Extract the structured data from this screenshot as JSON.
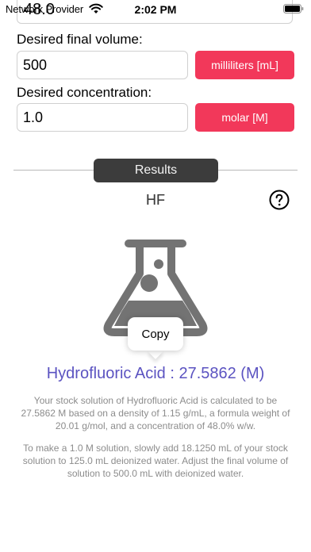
{
  "status_bar": {
    "carrier": "Network Provider",
    "time": "2:02 PM",
    "wifi_icon": "wifi-icon",
    "battery_icon": "battery-icon"
  },
  "form": {
    "top_field_value": "48.0",
    "volume_label": "Desired final volume:",
    "volume_value": "500",
    "volume_unit": "milliliters [mL]",
    "concentration_label": "Desired concentration:",
    "concentration_value": "1.0",
    "concentration_unit": "molar [M]"
  },
  "results": {
    "header": "Results",
    "formula": "HF",
    "help_icon": "question-circle-icon",
    "flask_icon": "flask-icon",
    "copy_label": "Copy",
    "title": "Hydrofluoric Acid : 27.5862 (M)",
    "paragraph_1": "Your stock solution of Hydrofluoric Acid is calculated to be 27.5862 M based on a density of 1.15 g/mL, a formula weight of 20.01 g/mol, and a concentration of 48.0% w/w.",
    "paragraph_2": "To make a 1.0 M solution, slowly add 18.1250 mL of your stock solution to 125.0 mL deionized water. Adjust the final volume of solution to 500.0 mL with deionized water."
  },
  "colors": {
    "accent_button": "#f2385a",
    "result_title": "#5b53c1",
    "results_pill": "#3c3c3c",
    "flask": "#737373"
  }
}
